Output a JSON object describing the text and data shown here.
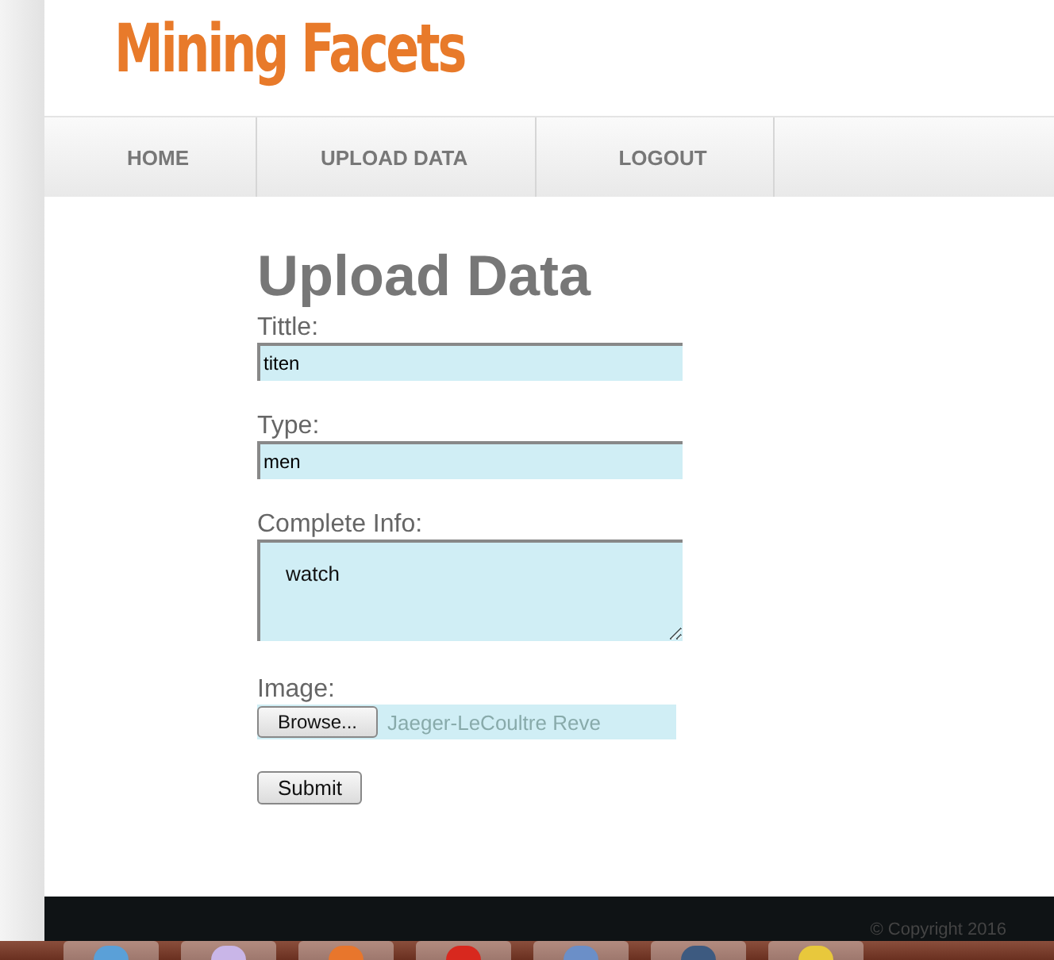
{
  "logo": "Mining Facets",
  "nav": [
    {
      "label": "HOME",
      "selected": false
    },
    {
      "label": "UPLOAD DATA",
      "selected": false
    },
    {
      "label": "LOGOUT",
      "selected": false
    }
  ],
  "page_title": "Upload Data",
  "form": {
    "title_label": "Tittle:",
    "title_value": "titen",
    "type_label": "Type:",
    "type_value": "men",
    "info_label": "Complete Info:",
    "info_value": "watch",
    "image_label": "Image:",
    "browse_button": "Browse...",
    "file_name": "Jaeger-LeCoultre Reve",
    "submit_button": "Submit"
  },
  "footer": {
    "copyright": "© Copyright 2016"
  }
}
